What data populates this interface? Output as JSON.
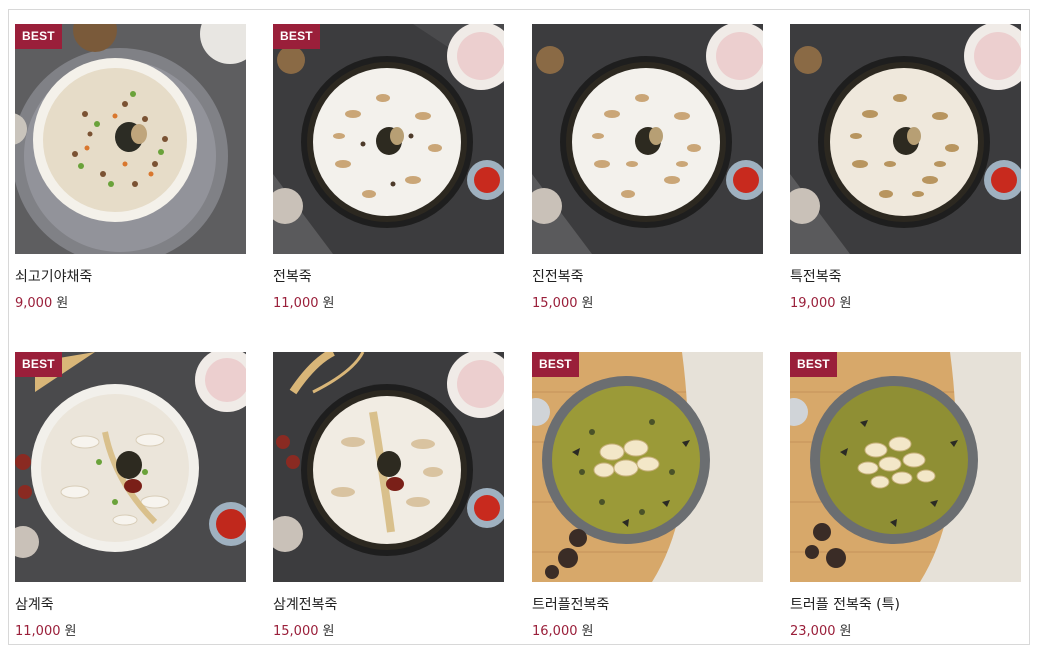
{
  "badge_label": "BEST",
  "currency": "원",
  "colors": {
    "badge": "#9a1f3a",
    "price": "#9a1f3a"
  },
  "products": [
    {
      "name": "쇠고기야채죽",
      "price": "9,000",
      "best": true,
      "image": "beef-vegetable-porridge-photo"
    },
    {
      "name": "전복죽",
      "price": "11,000",
      "best": true,
      "image": "abalone-porridge-photo"
    },
    {
      "name": "진전복죽",
      "price": "15,000",
      "best": false,
      "image": "premium-abalone-porridge-photo"
    },
    {
      "name": "특전복죽",
      "price": "19,000",
      "best": false,
      "image": "special-abalone-porridge-photo"
    },
    {
      "name": "삼계죽",
      "price": "11,000",
      "best": true,
      "image": "ginseng-chicken-porridge-photo"
    },
    {
      "name": "삼계전복죽",
      "price": "15,000",
      "best": false,
      "image": "ginseng-chicken-abalone-porridge-photo"
    },
    {
      "name": "트러플전복죽",
      "price": "16,000",
      "best": true,
      "image": "truffle-abalone-porridge-photo"
    },
    {
      "name": "트러플 전복죽 (특)",
      "price": "23,000",
      "best": true,
      "image": "special-truffle-abalone-porridge-photo"
    }
  ]
}
